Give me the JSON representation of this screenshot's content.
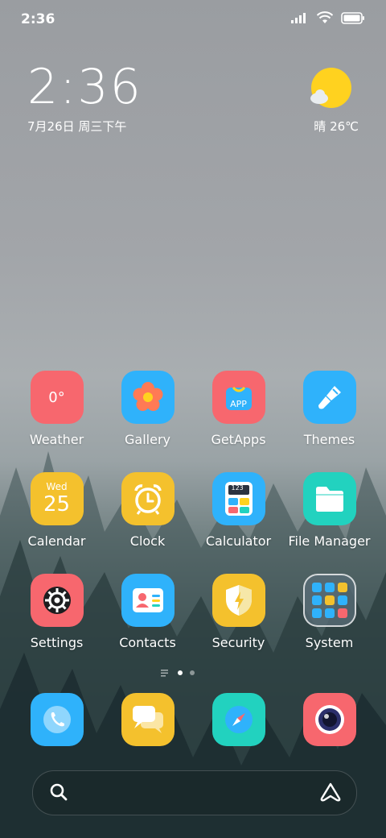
{
  "status_bar": {
    "time": "2:36"
  },
  "clock_widget": {
    "time": "2:36",
    "date": "7月26日 周三下午"
  },
  "weather_widget": {
    "text": "晴 26℃"
  },
  "apps": [
    {
      "label": "Weather",
      "icon": "weather-icon",
      "color": "#f7676e",
      "text": "0°"
    },
    {
      "label": "Gallery",
      "icon": "flower-icon",
      "color": "#2fb2fb"
    },
    {
      "label": "GetApps",
      "icon": "app-store-icon",
      "color": "#f7676e",
      "text": "APP"
    },
    {
      "label": "Themes",
      "icon": "brush-icon",
      "color": "#2fb2fb"
    },
    {
      "label": "Calendar",
      "icon": "calendar-icon",
      "color": "#f4c12d",
      "day": "Wed",
      "date": "25"
    },
    {
      "label": "Clock",
      "icon": "alarm-clock-icon",
      "color": "#f4c12d"
    },
    {
      "label": "Calculator",
      "icon": "calculator-icon",
      "color": "#2fb2fb",
      "text": "123"
    },
    {
      "label": "File Manager",
      "icon": "folder-icon",
      "color": "#22d2bf"
    },
    {
      "label": "Settings",
      "icon": "gear-icon",
      "color": "#f7676e"
    },
    {
      "label": "Contacts",
      "icon": "contact-card-icon",
      "color": "#2fb2fb"
    },
    {
      "label": "Security",
      "icon": "shield-icon",
      "color": "#f4c12d"
    },
    {
      "label": "System",
      "icon": "folder-grid-icon",
      "color": "#8a9aa0"
    }
  ],
  "dock": [
    {
      "name": "phone",
      "icon": "phone-icon",
      "color": "#2fb2fb"
    },
    {
      "name": "messages",
      "icon": "chat-icon",
      "color": "#f4c12d"
    },
    {
      "name": "browser",
      "icon": "compass-icon",
      "color": "#22d2bf"
    },
    {
      "name": "camera",
      "icon": "camera-icon",
      "color": "#f7676e"
    }
  ],
  "search_bar": {
    "search_icon": "search-icon",
    "assistant_icon": "assistant-icon"
  }
}
